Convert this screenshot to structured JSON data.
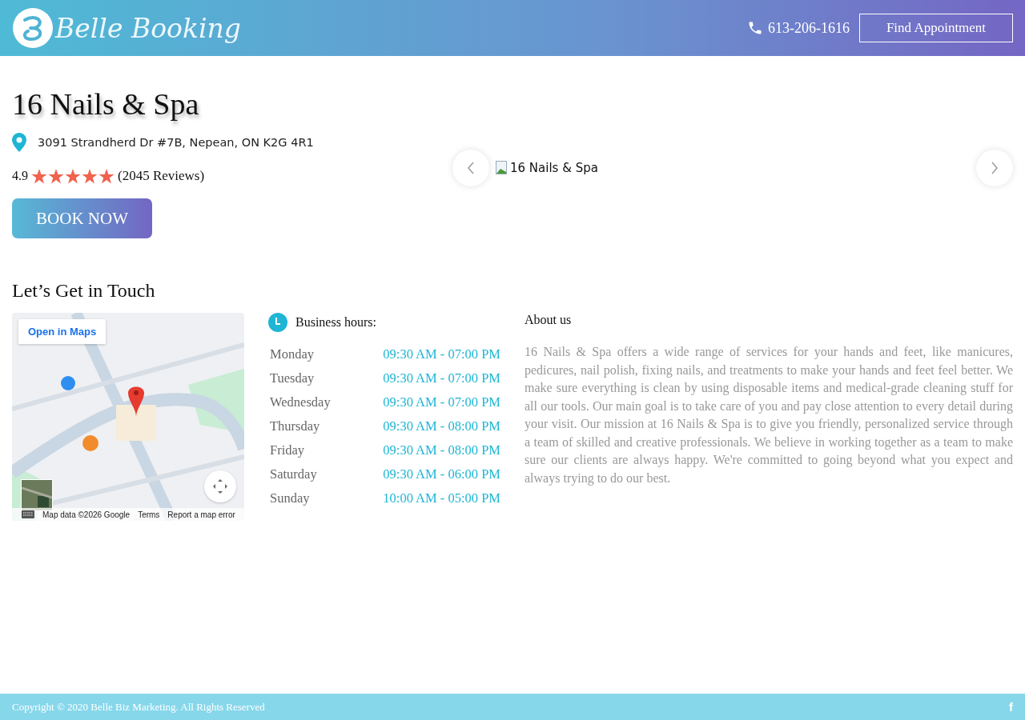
{
  "header": {
    "logo": "Belle Booking",
    "phone": "613-206-1616",
    "find_button": "Find Appointment"
  },
  "business": {
    "name": "16 Nails & Spa",
    "address": "3091 Strandherd Dr #7B, Nepean, ON K2G 4R1",
    "rating": "4.9",
    "stars": 5,
    "reviews": "(2045 Reviews)",
    "book_button": "BOOK NOW"
  },
  "gallery": {
    "image_alt": "16 Nails & Spa"
  },
  "contact": {
    "title": "Let’s Get in Touch",
    "map": {
      "open_button": "Open in Maps",
      "attribution": [
        "Map data ©2026 Google",
        "Terms",
        "Report a map error"
      ]
    },
    "hours_title": "Business hours:",
    "hours": [
      {
        "day": "Monday",
        "time": "09:30 AM - 07:00 PM"
      },
      {
        "day": "Tuesday",
        "time": "09:30 AM - 07:00 PM"
      },
      {
        "day": "Wednesday",
        "time": "09:30 AM - 07:00 PM"
      },
      {
        "day": "Thursday",
        "time": "09:30 AM - 08:00 PM"
      },
      {
        "day": "Friday",
        "time": "09:30 AM - 08:00 PM"
      },
      {
        "day": "Saturday",
        "time": "09:30 AM - 06:00 PM"
      },
      {
        "day": "Sunday",
        "time": "10:00 AM - 05:00 PM"
      }
    ],
    "about_title": "About us",
    "about_text": "16 Nails & Spa offers a wide range of services for your hands and feet, like manicures, pedicures, nail polish, fixing nails, and treatments to make your hands and feet feel better. We make sure everything is clean by using disposable items and medical-grade cleaning stuff for all our tools. Our main goal is to take care of you and pay close attention to every detail during your visit. Our mission at 16 Nails & Spa is to give you friendly, personalized service through a team of skilled and creative professionals. We believe in working together as a team to make sure our clients are always happy. We're committed to going beyond what you expect and always trying to do our best."
  },
  "footer": {
    "copyright": "Copyright © 2020 Belle Biz Marketing. All Rights Reserved",
    "social": "f"
  }
}
